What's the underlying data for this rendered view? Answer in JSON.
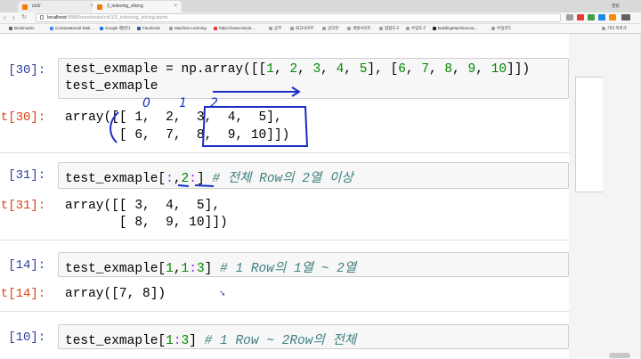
{
  "browser": {
    "tabs": [
      {
        "label": "ch3/"
      },
      {
        "label": "3_indexing_slicing"
      }
    ],
    "window_user": "샘탕",
    "url_host": "localhost",
    "url_path": ":8888/notebooks/ch/3/3_indexing_slicing.ipynb",
    "bookmarks": [
      {
        "label": "Bookmarks",
        "color": "#5f6368"
      },
      {
        "label": "Computational Stati...",
        "color": "#4285f4"
      },
      {
        "label": "Google 캘린더",
        "color": "#1a73e8"
      },
      {
        "label": "Facebook",
        "color": "#3b5998"
      },
      {
        "label": "Machine Learning",
        "color": "#9e9e9e"
      },
      {
        "label": "https://www.storyti...",
        "color": "#e53935"
      },
      {
        "label": "공부",
        "color": "#9e9e9e"
      },
      {
        "label": "회고사이트",
        "color": "#9e9e9e"
      },
      {
        "label": "공모전",
        "color": "#9e9e9e"
      },
      {
        "label": "개발사이트",
        "color": "#9e9e9e"
      },
      {
        "label": "협업도구",
        "color": "#9e9e9e"
      },
      {
        "label": "수업도구",
        "color": "#9e9e9e"
      },
      {
        "label": "BuildingMachineLea...",
        "color": "#222222"
      },
      {
        "label": "수업코드",
        "color": "#9e9e9e"
      },
      {
        "label": "기타 북마크",
        "color": "#9e9e9e"
      }
    ]
  },
  "cells": {
    "c30": {
      "in_prompt": "In [30]:",
      "out_prompt": "Out[30]:",
      "code_line1_var": "test_exmaple",
      "code_line1_eq": " = np.array([[",
      "n1": "1",
      "n2": "2",
      "n3": "3",
      "n4": "4",
      "n5": "5",
      "n6": "6",
      "n7": "7",
      "n8": "8",
      "n9": "9",
      "n10": "10",
      "comma": ", ",
      "mid": "], [",
      "close": "]])",
      "code_line2": "test_exmaple",
      "out_line1": "array([[ 1,  2,  3,  4,  5],",
      "out_line2": "       [ 6,  7,  8,  9, 10]])"
    },
    "c31": {
      "in_prompt": "In [31]:",
      "out_prompt": "Out[31]:",
      "code_head": "test_exmaple[",
      "code_colon": ":",
      "code_comma": ",",
      "code_two": "2",
      "code_tail": "] ",
      "comment": "# 전체 Row의 2열 이상",
      "out_line1": "array([[ 3,  4,  5],",
      "out_line2": "       [ 8,  9, 10]])"
    },
    "c14": {
      "in_prompt": "In [14]:",
      "out_prompt": "Out[14]:",
      "code_head": "test_exmaple[",
      "n_a": "1",
      "code_comma": ",",
      "n_b": "1",
      "code_colon": ":",
      "n_c": "3",
      "code_tail": "] ",
      "comment": "# 1 Row의 1열 ~ 2열",
      "out_line1": "array([7, 8])"
    },
    "c10": {
      "in_prompt": "In [10]:",
      "code_head": "test_exmaple[",
      "n_a": "1",
      "code_colon": ":",
      "n_b": "3",
      "code_tail": "] ",
      "comment": "# 1 Row ~ 2Row의 전체"
    }
  },
  "annotations": {
    "col0": "0",
    "col1": "1",
    "col2": "2"
  }
}
